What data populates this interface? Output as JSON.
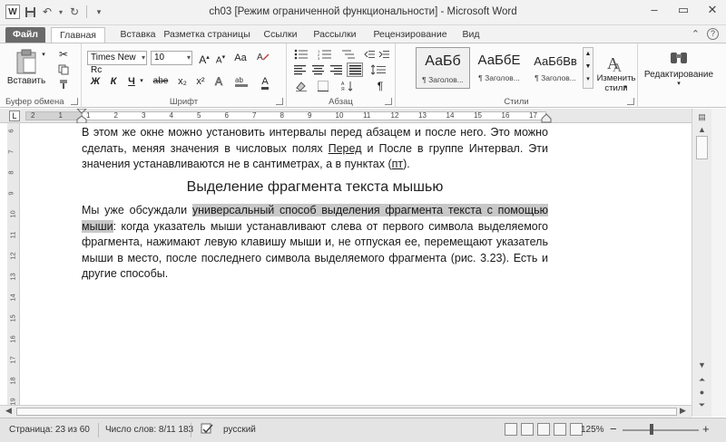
{
  "window": {
    "title": "ch03 [Режим ограниченной функциональности]  -  Microsoft Word",
    "controls": [
      "minimize-icon",
      "maximize-icon",
      "close-icon"
    ]
  },
  "qat": {
    "word_logo": "W"
  },
  "tabs": {
    "file": "Файл",
    "items": [
      "Главная",
      "Вставка",
      "Разметка страницы",
      "Ссылки",
      "Рассылки",
      "Рецензирование",
      "Вид"
    ],
    "active": "Главная"
  },
  "ribbon": {
    "clipboard": {
      "label": "Буфер обмена",
      "paste": "Вставить"
    },
    "font": {
      "label": "Шрифт",
      "font_name": "Times New Rc",
      "font_size": "10",
      "grow": "A",
      "shrink": "A",
      "aa": "Aa",
      "bold": "Ж",
      "italic": "К",
      "underline": "Ч",
      "strike": "abe",
      "sub": "x₂",
      "sup": "x²",
      "color_a": "A"
    },
    "paragraph": {
      "label": "Абзац",
      "pilcrow": "¶"
    },
    "styles": {
      "label": "Стили",
      "items": [
        {
          "preview": "АаБб",
          "name": "¶ Заголов..."
        },
        {
          "preview": "АаБбЕ",
          "name": "¶ Заголов..."
        },
        {
          "preview": "АаБбВв",
          "name": "¶ Заголов..."
        }
      ],
      "change_styles": "Изменить",
      "change_styles_2": "стили"
    },
    "editing": {
      "label": "Редактирование"
    }
  },
  "ruler": {
    "numbers": [
      "2",
      "1",
      "1",
      "2",
      "3",
      "4",
      "5",
      "6",
      "7",
      "8",
      "9",
      "10",
      "11",
      "12",
      "13",
      "14",
      "15",
      "16",
      "17"
    ],
    "vnumbers": [
      "6",
      "7",
      "8",
      "9",
      "10",
      "11",
      "12",
      "13",
      "14",
      "15",
      "16",
      "17",
      "18",
      "19"
    ]
  },
  "document": {
    "para1_a": "В этом же окне можно установить интервалы перед абзацем и после него. Это можно сделать, меняя значения в числовых полях ",
    "para1_b": "Перед",
    "para1_c": " и ",
    "para1_d": "После",
    "para1_e": " в группе ",
    "para1_f": "Интервал",
    "para1_g": ". Эти значения устанавливаются не в сантиметрах, а в пунктах (",
    "para1_h": "пт",
    "para1_i": ").",
    "heading": "Выделение фрагмента текста мышью",
    "para2_a": "Мы уже обсуждали ",
    "para2_b": "универсальный способ выделения фрагмента текста с помощью мыши",
    "para2_c": ": когда указатель мыши устанавливают слева от первого символа выделяемого фрагмента, нажимают левую клавишу мыши и, не отпуская ее, перемещают указатель мыши в место, после последнего символа выделяемого фрагмента (рис. 3.23). Есть и другие способы."
  },
  "statusbar": {
    "page": "Страница: 23 из 60",
    "words": "Число слов: 8/11 183",
    "language": "русский",
    "zoom": "125%",
    "minus": "−",
    "plus": "+"
  }
}
